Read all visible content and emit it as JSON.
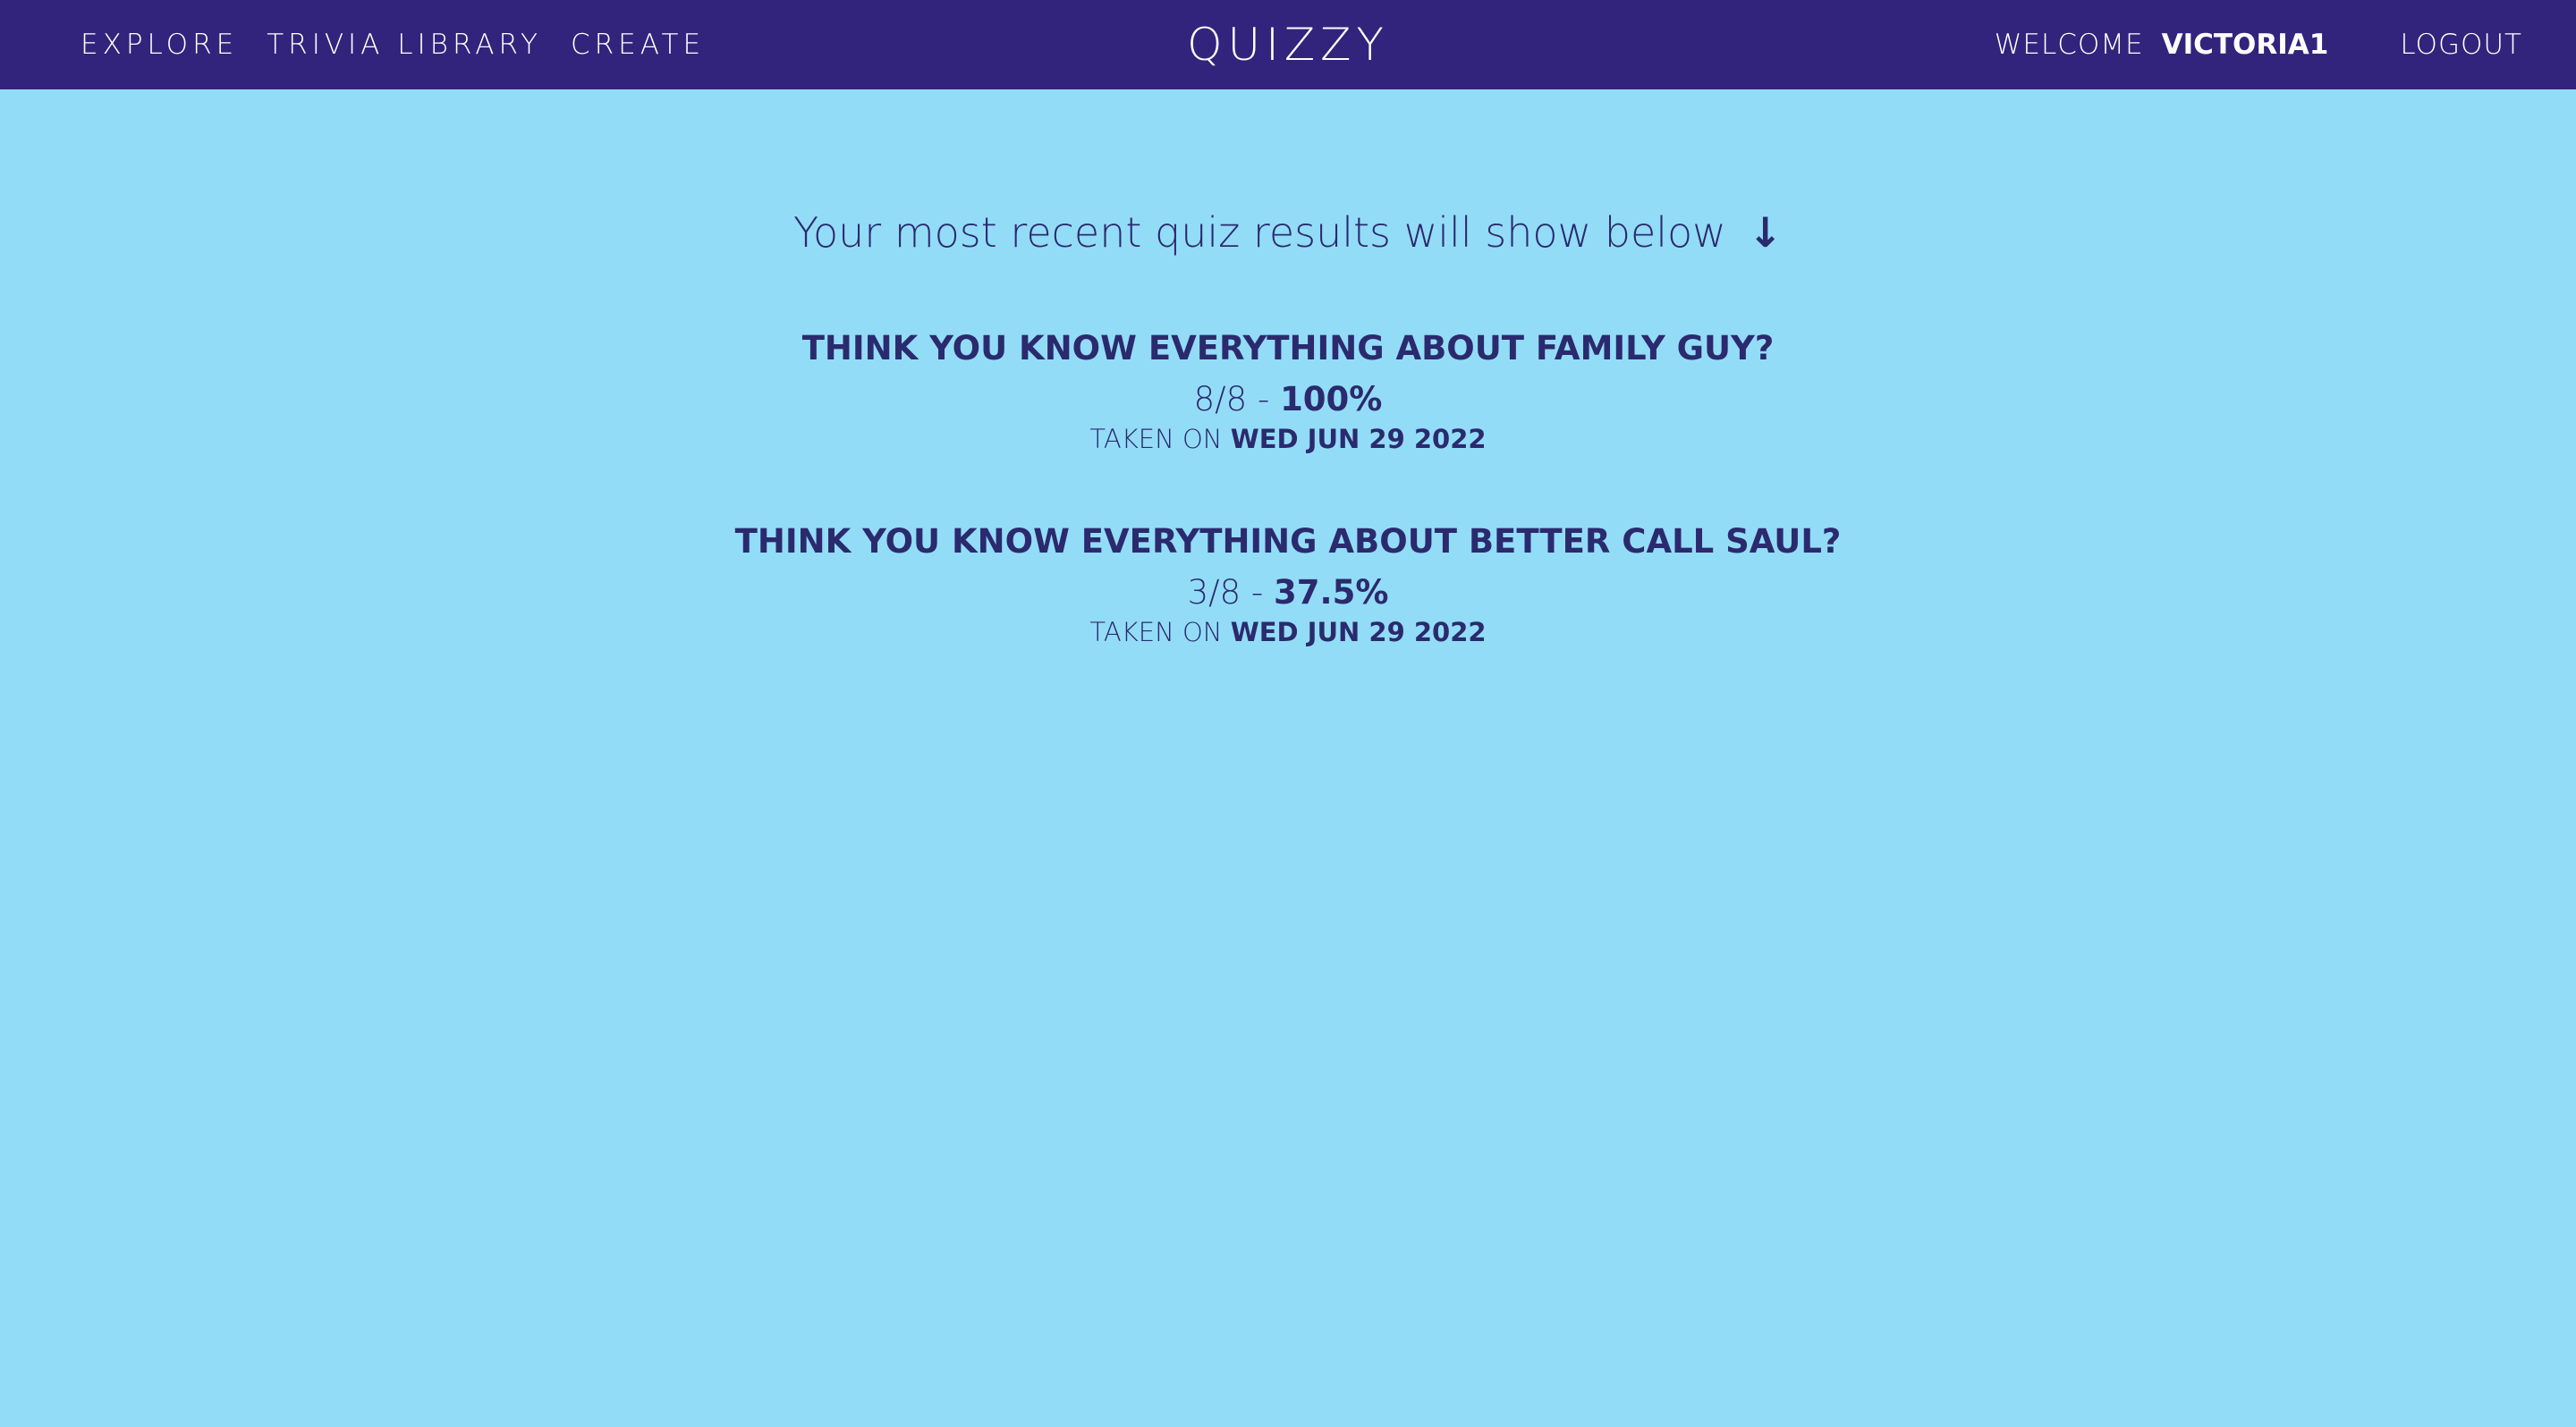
{
  "nav": {
    "links": [
      "EXPLORE",
      "TRIVIA LIBRARY",
      "CREATE"
    ],
    "brand": "QUIZZY",
    "welcome_label": "WELCOME",
    "username": "VICTORIA1",
    "logout_label": "LOGOUT"
  },
  "intro": {
    "text": "Your most recent quiz results will show below",
    "arrow": "↓"
  },
  "results": [
    {
      "title": "THINK YOU KNOW EVERYTHING ABOUT FAMILY GUY?",
      "score": "8/8",
      "separator": "-",
      "percent": "100%",
      "taken_label": "TAKEN ON",
      "date": "WED JUN 29 2022"
    },
    {
      "title": "THINK YOU KNOW EVERYTHING ABOUT BETTER CALL SAUL?",
      "score": "3/8",
      "separator": "-",
      "percent": "37.5%",
      "taken_label": "TAKEN ON",
      "date": "WED JUN 29 2022"
    }
  ],
  "colors": {
    "navbar": "#32247c",
    "background": "#93dcf8",
    "text": "#2b2a6e"
  }
}
